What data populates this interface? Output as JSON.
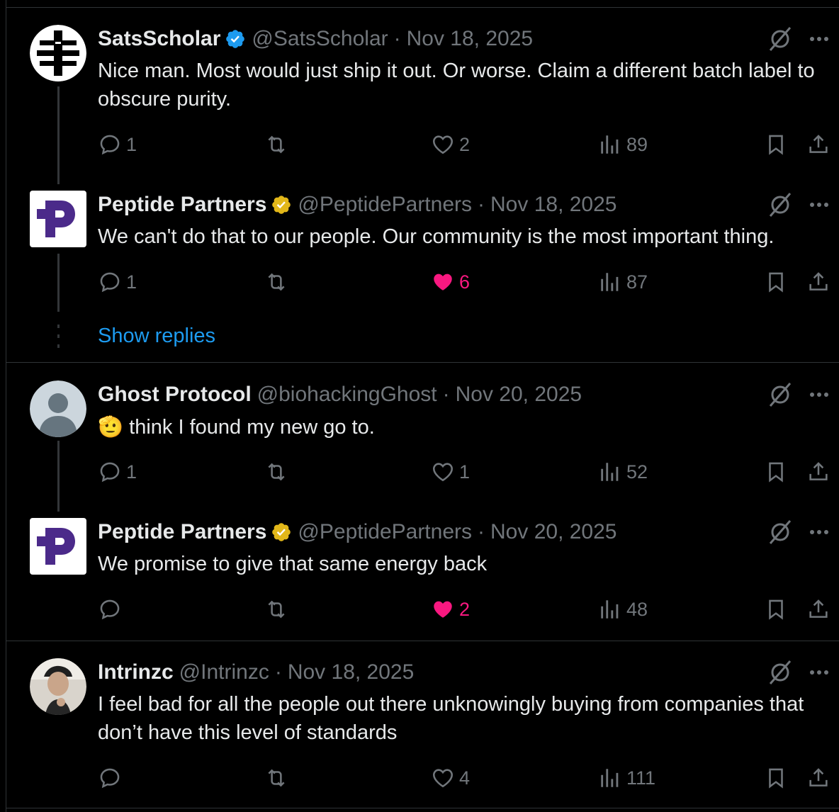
{
  "colors": {
    "background": "#000000",
    "text": "#e7e9ea",
    "muted": "#71767b",
    "accent_blue": "#1d9bf0",
    "like_pink": "#f91880",
    "verified_blue": "#1d9bf0",
    "verified_gold": "#e2b719",
    "brand_purple": "#4b2a8a"
  },
  "tweets": [
    {
      "name": "SatsScholar",
      "handle": "@SatsScholar",
      "time": "Nov 18, 2025",
      "text": "Nice man. Most would just ship it out. Or worse. Claim a different batch label to obscure purity.",
      "verified": "blue",
      "avatar_icon": "satsscholar-logo",
      "replies": "1",
      "retweets": "",
      "likes": "2",
      "views": "89",
      "liked": false
    },
    {
      "name": "Peptide Partners",
      "handle": "@PeptidePartners",
      "time": "Nov 18, 2025",
      "text": "We can't do that to our people. Our community is the most important thing.",
      "verified": "gold",
      "avatar_icon": "peptide-partners-logo",
      "replies": "1",
      "retweets": "",
      "likes": "6",
      "views": "87",
      "liked": true
    },
    {
      "name": "Ghost Protocol",
      "handle": "@biohackingGhost",
      "time": "Nov 20, 2025",
      "text": "think I found my new go to.",
      "emoji": "🫡",
      "verified": "none",
      "avatar_icon": "default-user-avatar",
      "replies": "1",
      "retweets": "",
      "likes": "1",
      "views": "52",
      "liked": false
    },
    {
      "name": "Peptide Partners",
      "handle": "@PeptidePartners",
      "time": "Nov 20, 2025",
      "text": "We promise to give that same energy back",
      "verified": "gold",
      "avatar_icon": "peptide-partners-logo",
      "replies": "",
      "retweets": "",
      "likes": "2",
      "views": "48",
      "liked": true
    },
    {
      "name": "Intrinzc",
      "handle": "@Intrinzc",
      "time": "Nov 18, 2025",
      "text": "I feel bad for all the people out there unknowingly buying from companies that don’t have this level of standards",
      "verified": "none",
      "avatar_icon": "profile-photo",
      "replies": "",
      "retweets": "",
      "likes": "4",
      "views": "111",
      "liked": false
    }
  ],
  "show_replies_label": "Show replies",
  "icons": [
    "reply-icon",
    "retweet-icon",
    "like-icon",
    "views-icon",
    "bookmark-icon",
    "share-icon",
    "grok-icon",
    "more-icon",
    "verified-badge-icon"
  ]
}
